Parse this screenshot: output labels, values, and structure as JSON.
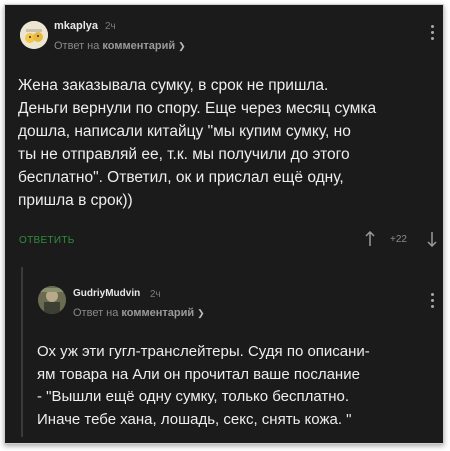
{
  "comment1": {
    "username": "mkaplya",
    "time": "2ч",
    "reply_prefix": "Ответ на",
    "reply_target": "комментарий",
    "text_lines": [
      "Жена заказывала сумку, в срок не пришла.",
      "Деньги вернули по спору. Еще через месяц сумка",
      "дошла, написали китайцу \"мы купим сумку, но",
      "ты не отправляй ее, т.к. мы получили до этого",
      "бесплатно\". Ответил, ок и прислал ещё одну,",
      "пришла в срок))"
    ],
    "reply_button": "ОТВЕТИТЬ",
    "score": "+22"
  },
  "comment2": {
    "username": "GudriyMudvin",
    "time": "2ч",
    "reply_prefix": "Ответ на",
    "reply_target": "комментарий",
    "text_lines": [
      "Ох уж эти гугл-транслейтеры. Судя по описани-",
      "ям товара на Али он прочитал ваше послание",
      "- \"Вышли ещё одну сумку, только бесплатно.",
      "Иначе тебе хана, лошадь, секс, снять кожа. \""
    ]
  },
  "icons": [
    "avatar-mkaplya",
    "avatar-gudriymudvin",
    "chevron-down-icon",
    "more-vertical-icon",
    "arrow-up-icon",
    "arrow-down-icon"
  ]
}
